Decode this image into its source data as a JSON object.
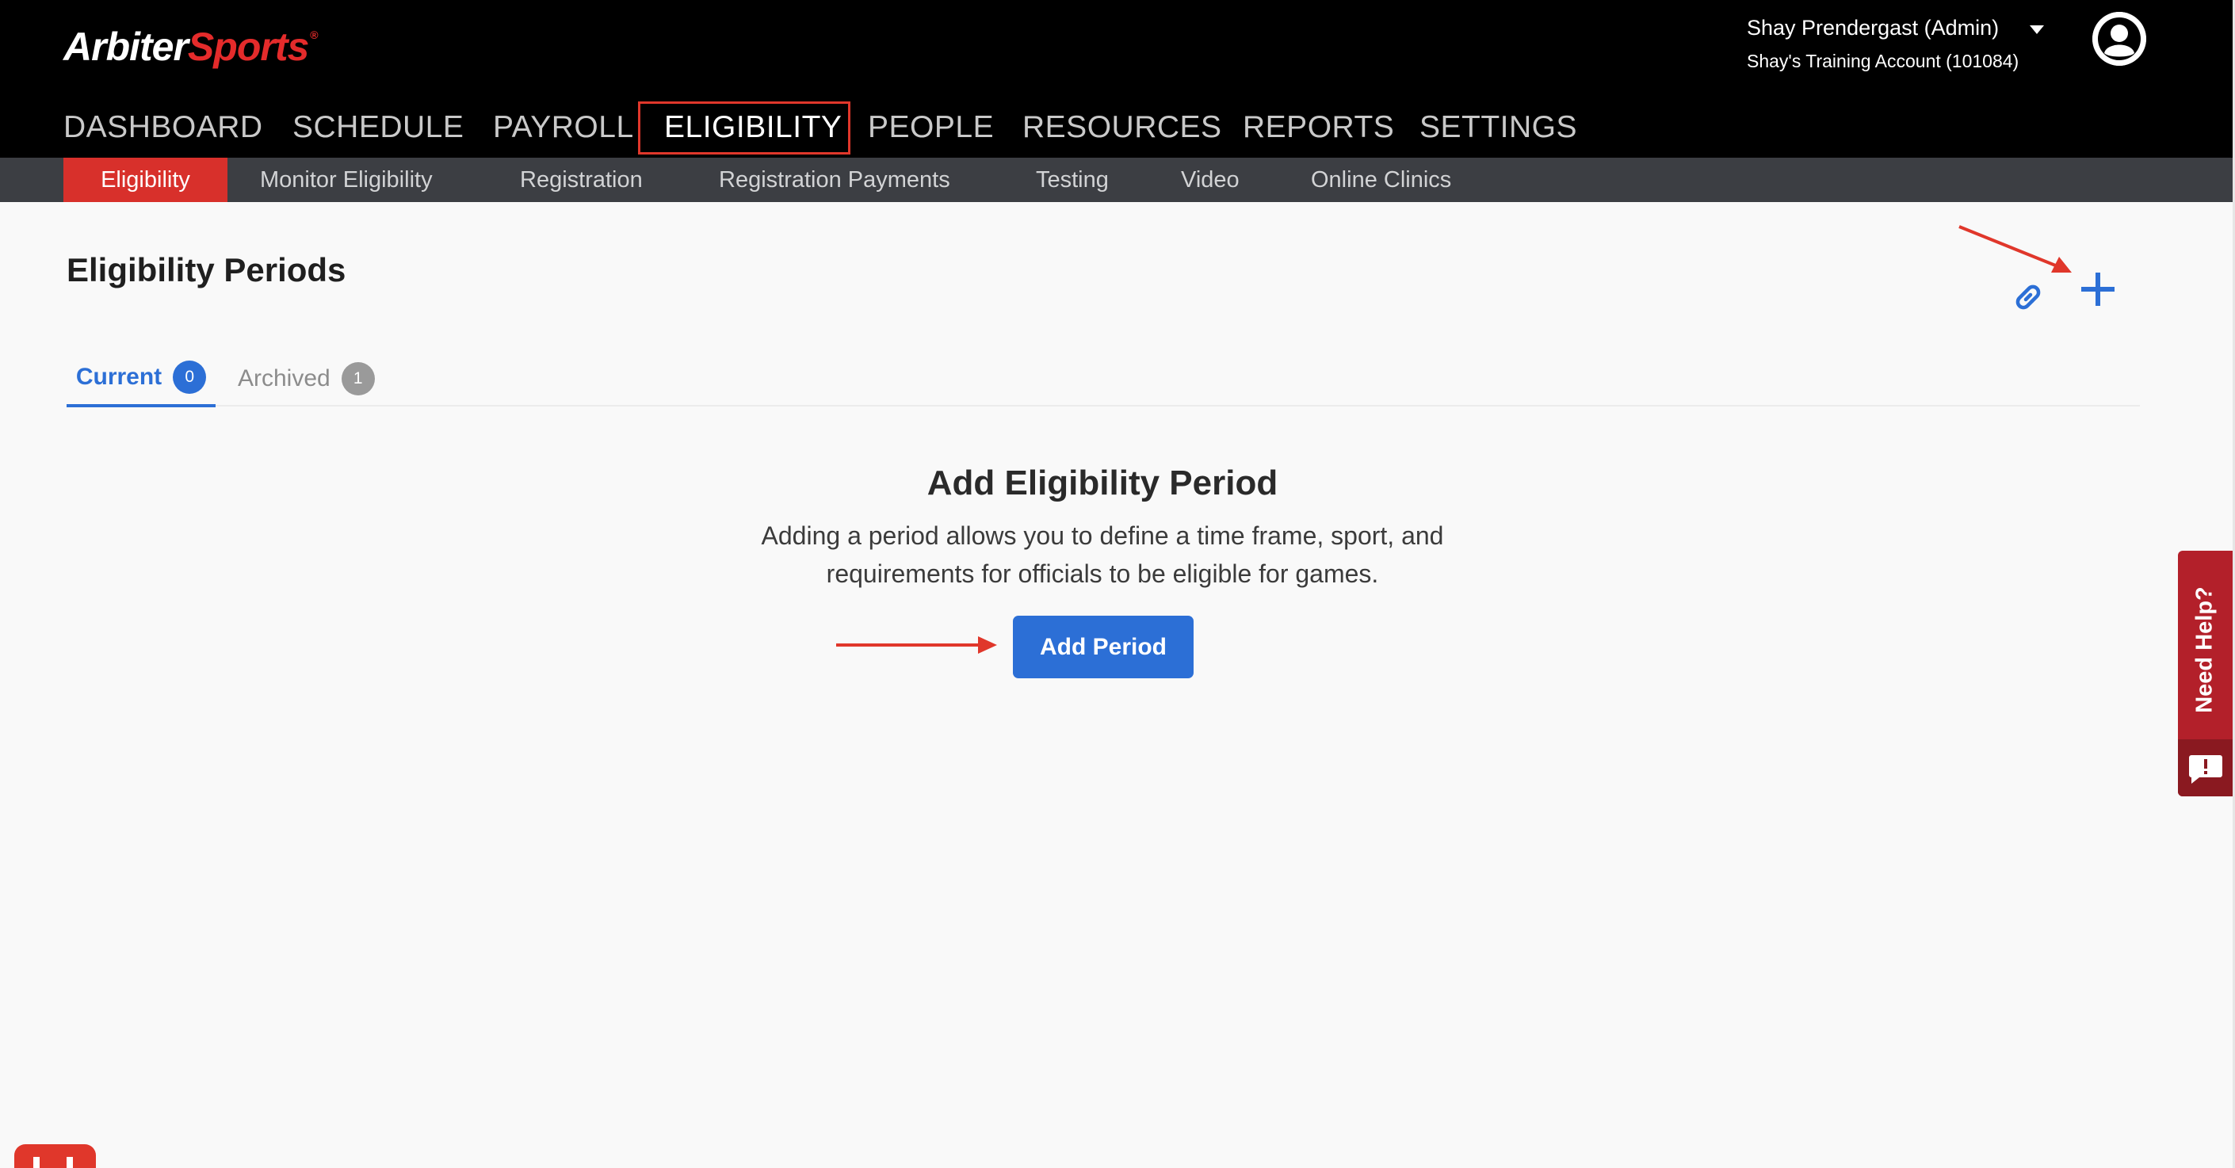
{
  "header": {
    "logo_part1": "Arbiter",
    "logo_part2": "Sports",
    "logo_tm": "®",
    "user_name": "Shay Prendergast (Admin)",
    "account": "Shay's Training Account (101084)"
  },
  "main_nav": [
    {
      "label": "DASHBOARD"
    },
    {
      "label": "SCHEDULE"
    },
    {
      "label": "PAYROLL"
    },
    {
      "label": "ELIGIBILITY",
      "active": true
    },
    {
      "label": "PEOPLE"
    },
    {
      "label": "RESOURCES"
    },
    {
      "label": "REPORTS"
    },
    {
      "label": "SETTINGS"
    }
  ],
  "sub_nav": [
    {
      "label": "Eligibility",
      "active": true
    },
    {
      "label": "Monitor Eligibility"
    },
    {
      "label": "Registration"
    },
    {
      "label": "Registration Payments"
    },
    {
      "label": "Testing"
    },
    {
      "label": "Video"
    },
    {
      "label": "Online Clinics"
    }
  ],
  "page": {
    "title": "Eligibility Periods",
    "tabs": [
      {
        "label": "Current",
        "count": "0"
      },
      {
        "label": "Archived",
        "count": "1"
      }
    ],
    "empty_state": {
      "title": "Add Eligibility Period",
      "line1": "Adding a period allows you to define a time frame, sport, and",
      "line2": "requirements for officials to be eligible for games.",
      "button": "Add Period"
    }
  },
  "help_widget": {
    "label": "Need Help?"
  },
  "icons": {
    "link": "link-icon",
    "add": "plus-icon",
    "avatar": "user-avatar-icon",
    "help": "chat-exclamation-icon",
    "caret": "caret-down-icon"
  },
  "colors": {
    "brand_red": "#e0372b",
    "primary_blue": "#2c6fd6",
    "header_bg": "#000000",
    "subnav_bg": "#3c3e43",
    "help_red": "#b3202a"
  }
}
